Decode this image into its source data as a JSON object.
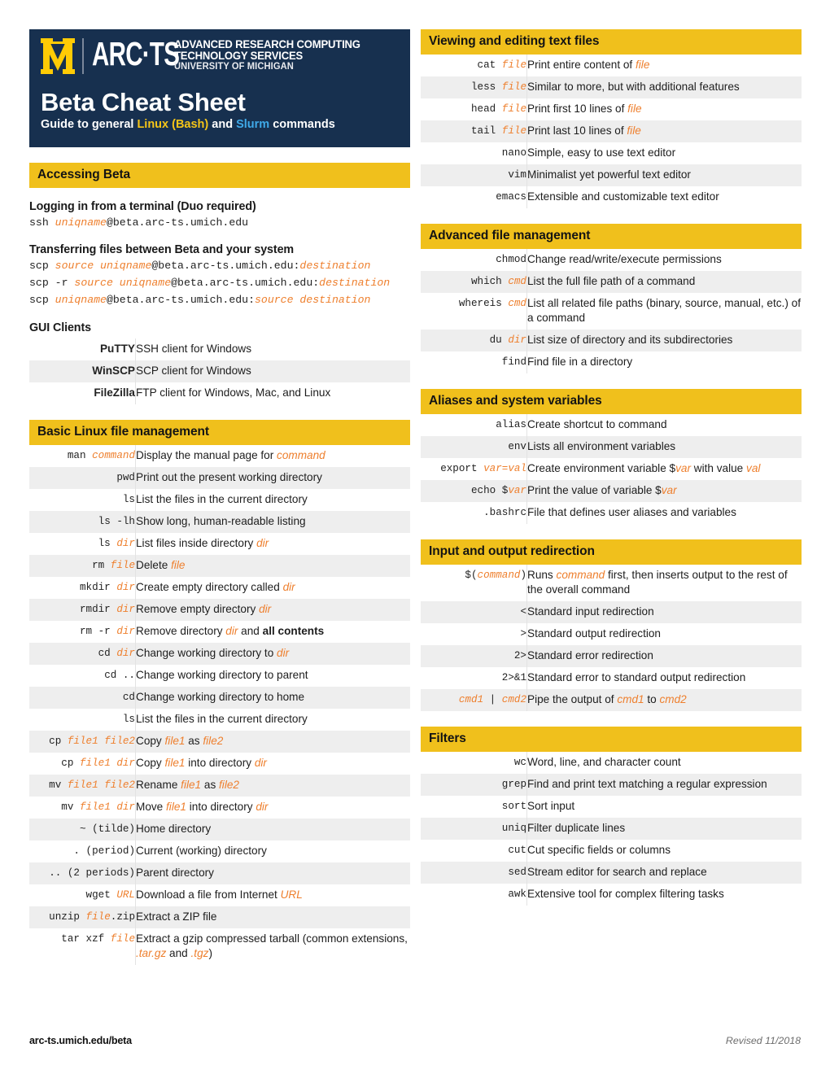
{
  "masthead": {
    "org_line1": "ADVANCED RESEARCH COMPUTING",
    "org_line2": "TECHNOLOGY SERVICES",
    "org_line3": "UNIVERSITY OF MICHIGAN",
    "wordmark": "ARC·TS",
    "title": "Beta Cheat Sheet",
    "subtitle_pre": "Guide to general ",
    "subtitle_linux": "Linux (Bash)",
    "subtitle_mid": " and ",
    "subtitle_slurm": "Slurm",
    "subtitle_post": " commands",
    "colors": {
      "navy": "#17304F",
      "maize": "#FFCB05",
      "linux": "#F5C518",
      "slurm": "#3FA9E8"
    }
  },
  "colors": {
    "bar": "#F0C01C",
    "arg_orange": "#EE7F2D",
    "row_alt": "#EEEEEE"
  },
  "accessing": {
    "bar": "Accessing Beta",
    "login_head": "Logging in from a terminal (Duo required)",
    "login_cmd": {
      "pre": "ssh ",
      "arg1": "uniqname",
      "post": "@beta.arc-ts.umich.edu"
    },
    "transfer_head": "Transferring files between Beta and your system",
    "transfer_cmds": [
      {
        "pre": "scp ",
        "arg1": "source uniqname",
        "mid": "@beta.arc-ts.umich.edu:",
        "arg2": "destination"
      },
      {
        "pre": "scp -r ",
        "arg1": "source uniqname",
        "mid": "@beta.arc-ts.umich.edu:",
        "arg2": "destination"
      },
      {
        "pre": "scp ",
        "arg1": "uniqname",
        "mid": "@beta.arc-ts.umich.edu:",
        "arg2": "source destination"
      }
    ],
    "gui_head": "GUI Clients",
    "gui_rows": [
      {
        "name": "PuTTY",
        "desc": "SSH client for Windows"
      },
      {
        "name": "WinSCP",
        "desc": "SCP client for Windows"
      },
      {
        "name": "FileZilla",
        "desc": "FTP client for Windows, Mac, and Linux"
      }
    ]
  },
  "basic": {
    "bar": "Basic Linux file management",
    "rows": [
      {
        "cmd": "man ",
        "cmd_arg": "command",
        "desc_pre": "Display the manual page for ",
        "desc_arg": "command"
      },
      {
        "cmd": "pwd",
        "desc_pre": "Print out the present working directory"
      },
      {
        "cmd": "ls",
        "desc_pre": "List the files in the current directory"
      },
      {
        "cmd": "ls -lh",
        "desc_pre": "Show long, human-readable listing"
      },
      {
        "cmd": "ls ",
        "cmd_arg": "dir",
        "desc_pre": "List files inside directory ",
        "desc_arg": "dir"
      },
      {
        "cmd": "rm ",
        "cmd_arg": "file",
        "desc_pre": "Delete ",
        "desc_arg": "file"
      },
      {
        "cmd": "mkdir ",
        "cmd_arg": "dir",
        "desc_pre": "Create empty directory called ",
        "desc_arg": "dir"
      },
      {
        "cmd": "rmdir ",
        "cmd_arg": "dir",
        "desc_pre": "Remove empty directory ",
        "desc_arg": "dir"
      },
      {
        "cmd": "rm -r ",
        "cmd_arg": "dir",
        "desc_pre": "Remove directory ",
        "desc_arg": "dir",
        "desc_post": " and ",
        "desc_bold": "all contents"
      },
      {
        "cmd": "cd ",
        "cmd_arg": "dir",
        "desc_pre": "Change working directory to ",
        "desc_arg": "dir"
      },
      {
        "cmd": "cd ..",
        "desc_pre": "Change working directory to parent"
      },
      {
        "cmd": "cd",
        "desc_pre": "Change working directory to home"
      },
      {
        "cmd": "ls",
        "desc_pre": "List the files in the current directory"
      },
      {
        "cmd": "cp ",
        "cmd_arg": "file1 file2",
        "desc_pre": "Copy ",
        "desc_arg": "file1",
        "desc_post": " as ",
        "desc_arg2": "file2"
      },
      {
        "cmd": "cp ",
        "cmd_arg": "file1 dir",
        "desc_pre": "Copy ",
        "desc_arg": "file1",
        "desc_post": " into directory ",
        "desc_arg2": "dir"
      },
      {
        "cmd": "mv ",
        "cmd_arg": "file1 file2",
        "desc_pre": "Rename ",
        "desc_arg": "file1",
        "desc_post": " as ",
        "desc_arg2": "file2"
      },
      {
        "cmd": "mv ",
        "cmd_arg": "file1 dir",
        "desc_pre": "Move ",
        "desc_arg": "file1",
        "desc_post": " into directory ",
        "desc_arg2": "dir"
      },
      {
        "cmd": "~ (tilde)",
        "desc_pre": "Home directory"
      },
      {
        "cmd": ". (period)",
        "desc_pre": "Current (working) directory"
      },
      {
        "cmd": ".. (2 periods)",
        "desc_pre": "Parent directory"
      },
      {
        "cmd": "wget ",
        "cmd_arg": "URL",
        "desc_pre": "Download a file from Internet ",
        "desc_arg": "URL"
      },
      {
        "cmd_pre": "unzip ",
        "cmd_arg": "file",
        "cmd_post": ".zip",
        "desc_pre": "Extract a ZIP file"
      },
      {
        "cmd": "tar xzf ",
        "cmd_arg": "file",
        "desc_pre": "Extract a gzip compressed tarball (common extensions, ",
        "desc_arg": ".tar.gz",
        "desc_post": " and ",
        "desc_arg2": ".tgz",
        "desc_tail": ")"
      }
    ]
  },
  "viewing": {
    "bar": "Viewing and editing text files",
    "rows": [
      {
        "cmd": "cat ",
        "cmd_arg": "file",
        "desc_pre": "Print entire content of ",
        "desc_arg": "file"
      },
      {
        "cmd": "less ",
        "cmd_arg": "file",
        "desc_pre": "Similar to more, but with additional features"
      },
      {
        "cmd": "head ",
        "cmd_arg": "file",
        "desc_pre": "Print first 10 lines of ",
        "desc_arg": "file"
      },
      {
        "cmd": "tail ",
        "cmd_arg": "file",
        "desc_pre": "Print last 10 lines of ",
        "desc_arg": "file"
      },
      {
        "cmd": "nano",
        "desc_pre": "Simple, easy to use text editor"
      },
      {
        "cmd": "vim",
        "desc_pre": "Minimalist yet powerful text editor"
      },
      {
        "cmd": "emacs",
        "desc_pre": "Extensible and customizable text editor"
      }
    ]
  },
  "advanced": {
    "bar": "Advanced file management",
    "rows": [
      {
        "cmd": "chmod",
        "desc_pre": "Change read/write/execute permissions"
      },
      {
        "cmd": "which ",
        "cmd_arg": "cmd",
        "desc_pre": "List the full file path of a command"
      },
      {
        "cmd": "whereis ",
        "cmd_arg": "cmd",
        "desc_pre": "List all related file paths (binary, source, manual, etc.) of a command"
      },
      {
        "cmd": "du ",
        "cmd_arg": "dir",
        "desc_pre": "List size of directory and its subdirectories"
      },
      {
        "cmd": "find",
        "desc_pre": "Find file in a directory"
      }
    ]
  },
  "aliases": {
    "bar": "Aliases and system variables",
    "rows": [
      {
        "cmd": "alias",
        "desc_pre": "Create shortcut to command"
      },
      {
        "cmd": "env",
        "desc_pre": "Lists all environment variables"
      },
      {
        "cmd": "export ",
        "cmd_arg": "var=val",
        "desc_pre": "Create environment variable $",
        "desc_arg": "var",
        "desc_post": " with value ",
        "desc_arg2": "val"
      },
      {
        "cmd": "echo $",
        "cmd_arg": "var",
        "desc_pre": "Print the value of variable $",
        "desc_arg": "var"
      },
      {
        "cmd": ".bashrc",
        "desc_pre": "File that defines user aliases and variables"
      }
    ]
  },
  "redirection": {
    "bar": "Input and output redirection",
    "rows": [
      {
        "cmd_pre": "$(",
        "cmd_arg": "command",
        "cmd_post": ")",
        "desc_pre": "Runs ",
        "desc_arg": "command",
        "desc_post": " first, then inserts output to the rest of the overall command"
      },
      {
        "cmd": "<",
        "desc_pre": "Standard input redirection"
      },
      {
        "cmd": ">",
        "desc_pre": "Standard output redirection"
      },
      {
        "cmd": "2>",
        "desc_pre": "Standard error redirection"
      },
      {
        "cmd": "2>&1",
        "desc_pre": "Standard error to standard output redirection"
      },
      {
        "cmd_arg": "cmd1",
        "cmd_mid": " | ",
        "cmd_arg2": "cmd2",
        "desc_pre": "Pipe the output of ",
        "desc_arg": "cmd1",
        "desc_post": " to ",
        "desc_arg2": "cmd2"
      }
    ]
  },
  "filters": {
    "bar": "Filters",
    "rows": [
      {
        "cmd": "wc",
        "desc_pre": "Word, line, and character count"
      },
      {
        "cmd": "grep",
        "desc_pre": "Find and print text matching a regular expression"
      },
      {
        "cmd": "sort",
        "desc_pre": "Sort input"
      },
      {
        "cmd": "uniq",
        "desc_pre": "Filter duplicate lines"
      },
      {
        "cmd": "cut",
        "desc_pre": "Cut specific fields or columns"
      },
      {
        "cmd": "sed",
        "desc_pre": "Stream editor for search and replace"
      },
      {
        "cmd": "awk",
        "desc_pre": "Extensive tool for complex filtering tasks"
      }
    ]
  },
  "footer": {
    "site": "arc-ts.umich.edu/beta",
    "revised": "Revised 11/2018"
  }
}
